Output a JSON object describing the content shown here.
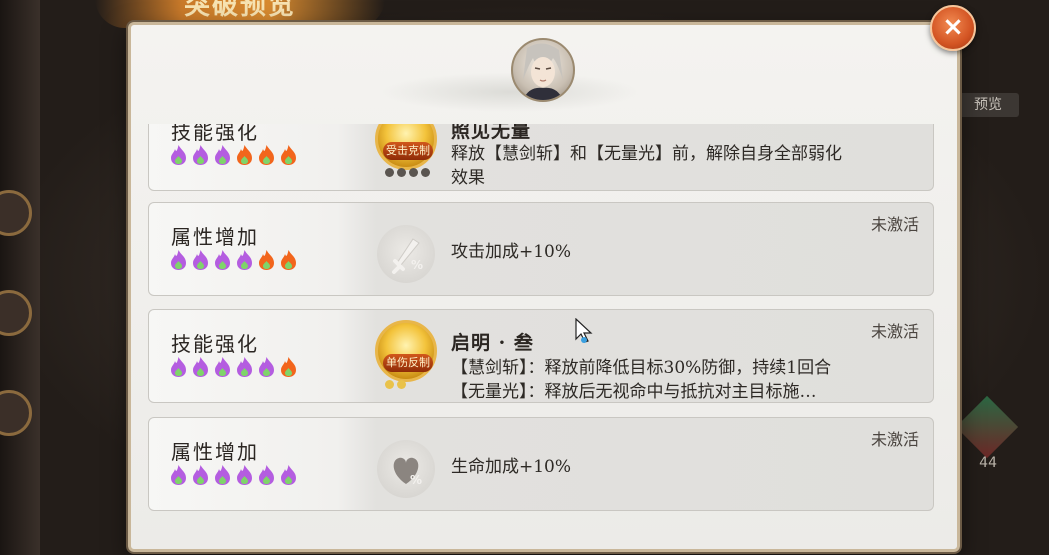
{
  "background": {
    "title": "突破预览",
    "right_chip": "预览",
    "right_count": "44"
  },
  "close_icon": "×",
  "rows": [
    {
      "category": "技能强化",
      "flames": [
        "purple",
        "purple",
        "purple",
        "orange",
        "orange",
        "orange"
      ],
      "icon_type": "skill",
      "icon_tag": "受击克制",
      "icon_dots_lit": 0,
      "title": "照见无量",
      "desc_lines": [
        "释放【慧剑斩】和【无量光】前，解除自身全部弱化",
        "效果"
      ],
      "status": ""
    },
    {
      "category": "属性增加",
      "flames": [
        "purple",
        "purple",
        "purple",
        "purple",
        "orange",
        "orange"
      ],
      "icon_type": "attack",
      "title": "",
      "desc_lines": [
        "攻击加成+10%"
      ],
      "status": "未激活"
    },
    {
      "category": "技能强化",
      "flames": [
        "purple",
        "purple",
        "purple",
        "purple",
        "purple",
        "orange"
      ],
      "icon_type": "skill",
      "icon_tag": "单伤反制",
      "icon_dots_lit": 2,
      "title": "启明 · 叁",
      "desc_lines": [
        "【慧剑斩】：释放前降低目标30%防御，持续1回合",
        "【无量光】：释放后无视命中与抵抗对主目标施…"
      ],
      "status": "未激活"
    },
    {
      "category": "属性增加",
      "flames": [
        "purple",
        "purple",
        "purple",
        "purple",
        "purple",
        "purple"
      ],
      "icon_type": "hp",
      "title": "",
      "desc_lines": [
        "生命加成+10%"
      ],
      "status": "未激活"
    }
  ],
  "colors": {
    "flame_purple": "#b45de0",
    "flame_orange": "#f2651c",
    "flame_green": "#7fd46a"
  }
}
